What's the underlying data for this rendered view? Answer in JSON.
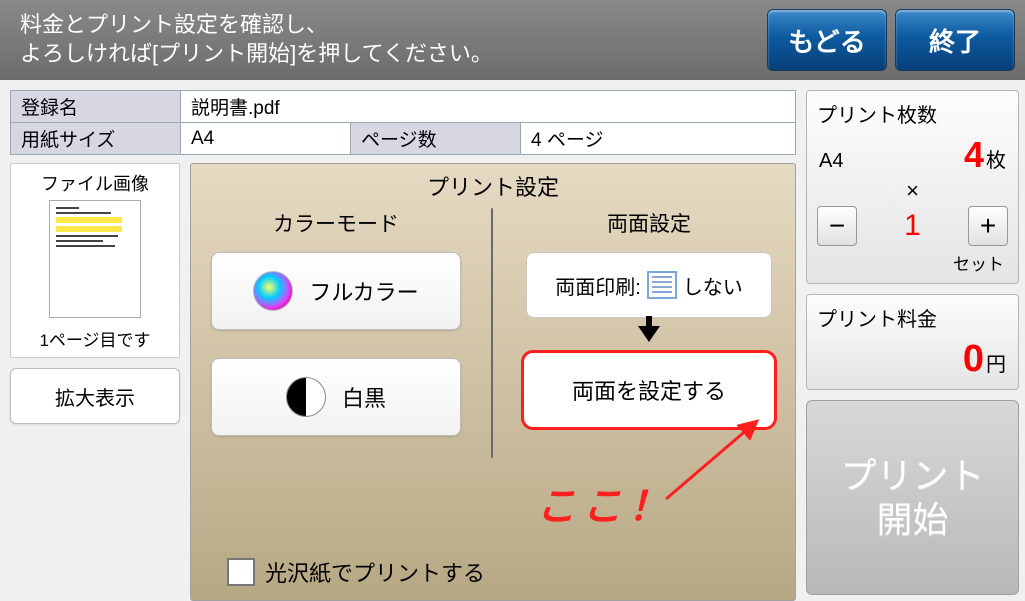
{
  "header": {
    "line1": "料金とプリント設定を確認し、",
    "line2": "よろしければ[プリント開始]を押してください。",
    "back": "もどる",
    "exit": "終了"
  },
  "info": {
    "filename_label": "登録名",
    "filename": "説明書.pdf",
    "paper_label": "用紙サイズ",
    "paper": "A4",
    "pages_label": "ページ数",
    "pages": "4 ページ"
  },
  "preview": {
    "title": "ファイル画像",
    "caption": "1ページ目です",
    "zoom": "拡大表示"
  },
  "settings": {
    "title": "プリント設定",
    "color_mode": "カラーモード",
    "full_color": "フルカラー",
    "bw": "白黒",
    "duplex_title": "両面設定",
    "duplex_label": "両面印刷:",
    "duplex_value": "しない",
    "duplex_set": "両面を設定する",
    "glossy": "光沢紙でプリントする"
  },
  "annotation": {
    "text": "ここ！"
  },
  "right": {
    "count_title": "プリント枚数",
    "paper": "A4",
    "sheets": "4",
    "sheets_unit": "枚",
    "sets": "1",
    "sets_unit": "セット",
    "price_title": "プリント料金",
    "price": "0",
    "price_unit": "円",
    "start_line1": "プリント",
    "start_line2": "開始"
  }
}
